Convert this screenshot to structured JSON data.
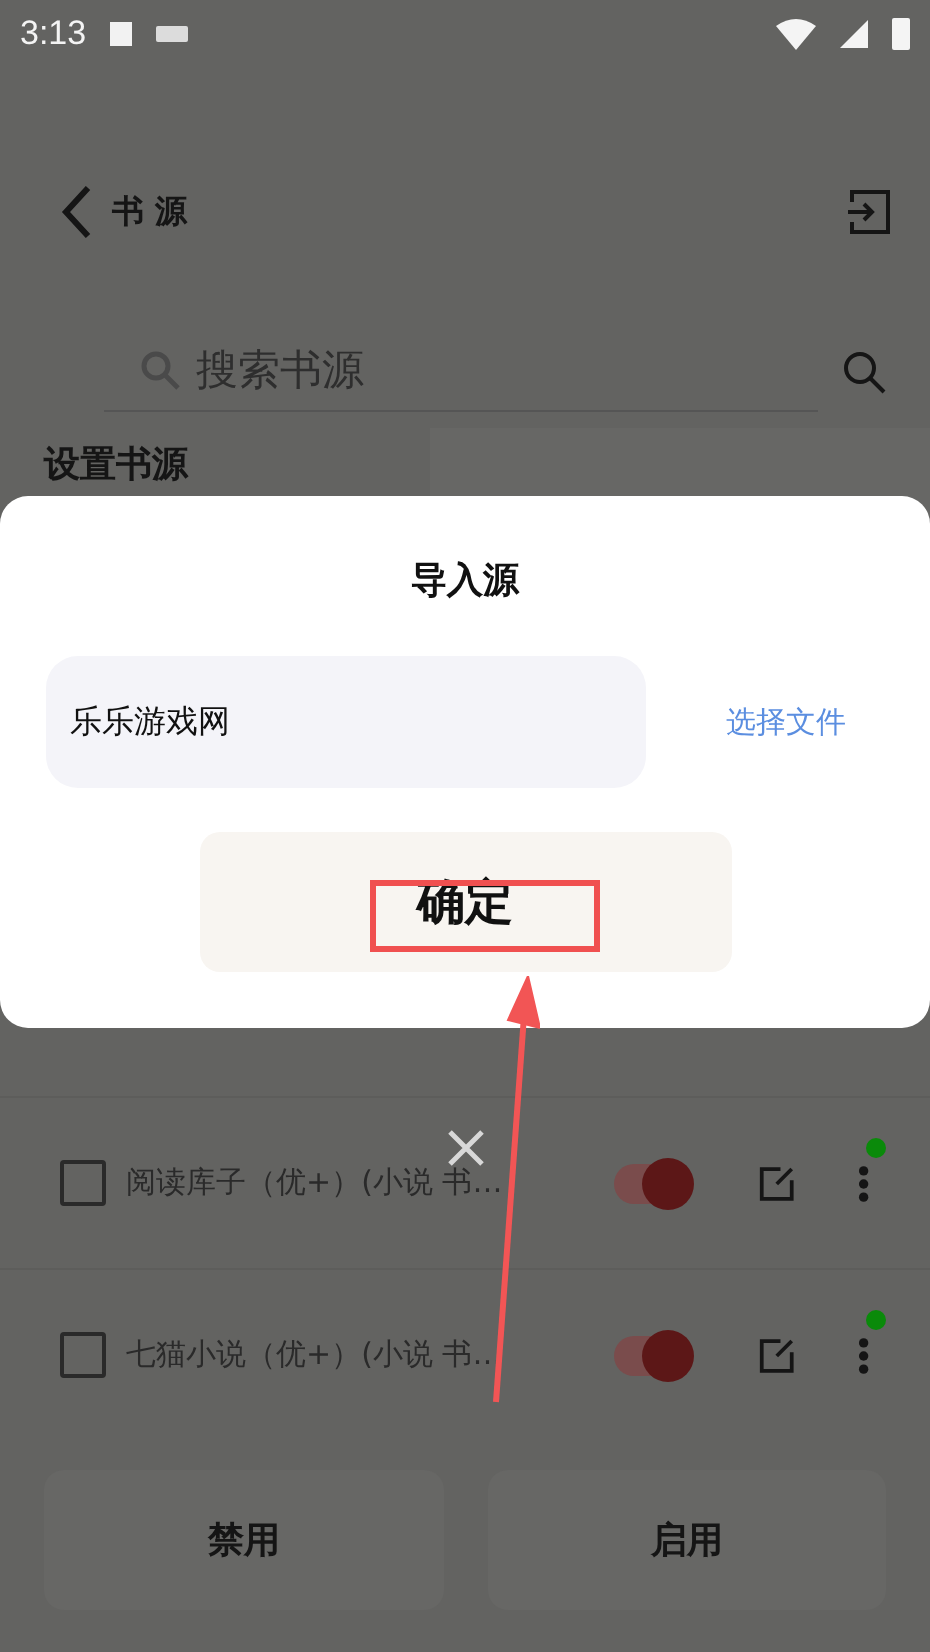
{
  "status_bar": {
    "time": "3:13"
  },
  "toolbar": {
    "title": "书 源"
  },
  "search": {
    "placeholder": "搜索书源"
  },
  "sidebar": {
    "title": "设置书源"
  },
  "sources": [
    {
      "name": "阅读库子（优+）(小说 书…",
      "checked": false,
      "enabled": true,
      "color": "#0a8a0a"
    },
    {
      "name": "七猫小说（优+）(小说 书…",
      "checked": false,
      "enabled": true,
      "color": "#0a8a0a"
    }
  ],
  "bottom_buttons": [
    "禁用",
    "启用"
  ],
  "dialog": {
    "title": "导入源",
    "input_value": "乐乐游戏网",
    "file_link": "选择文件",
    "confirm": "确定"
  }
}
